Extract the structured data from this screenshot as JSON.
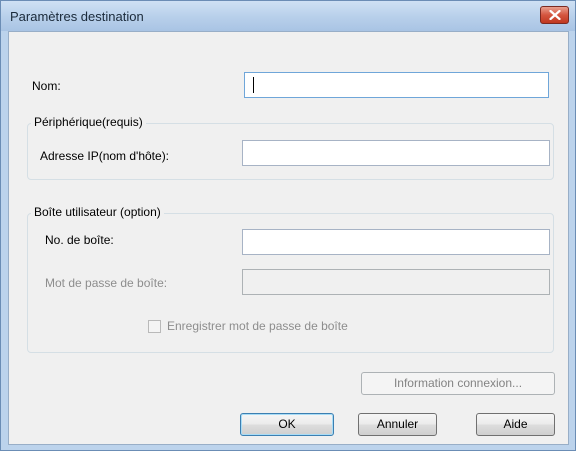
{
  "window": {
    "title": "Paramètres destination"
  },
  "fields": {
    "nom_label": "Nom:",
    "nom_value": "",
    "adresse_label": "Adresse IP(nom d'hôte):",
    "adresse_value": "",
    "no_boite_label": "No. de boîte:",
    "no_boite_value": "",
    "mot_de_passe_label": "Mot de passe de boîte:",
    "mot_de_passe_value": ""
  },
  "groups": {
    "peripherique_title": "Périphérique(requis)",
    "boite_title": "Boîte utilisateur (option)"
  },
  "checkbox": {
    "label": "Enregistrer mot de passe de boîte",
    "checked": false
  },
  "buttons": {
    "information": "Information connexion...",
    "ok": "OK",
    "annuler": "Annuler",
    "aide": "Aide"
  },
  "icons": {
    "close": "close-icon"
  },
  "colors": {
    "close_button": "#d4553f",
    "focus_border": "#6fa6d9"
  }
}
